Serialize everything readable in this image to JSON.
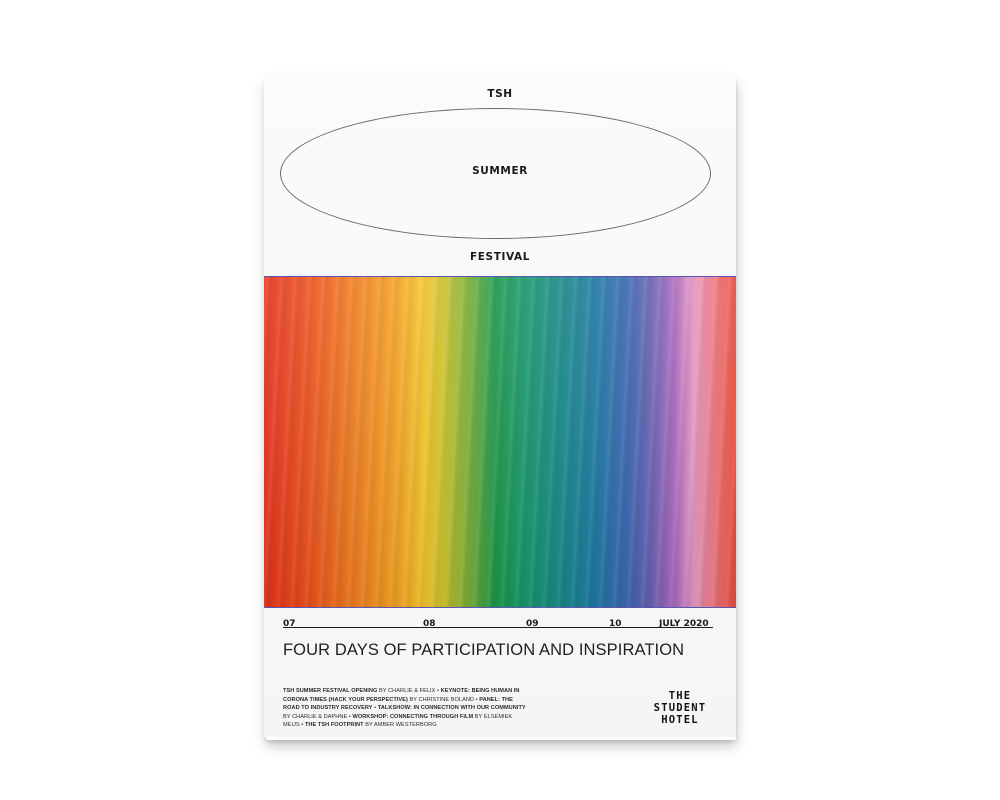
{
  "poster": {
    "title_top": "TSH",
    "title_middle": "SUMMER",
    "title_bottom": "FESTIVAL",
    "dates": [
      "07",
      "08",
      "09",
      "10",
      "JULY 2020"
    ],
    "tagline": "FOUR DAYS OF PARTICIPATION AND INSPIRATION",
    "program": [
      {
        "title": "TSH SUMMER FESTIVAL OPENING",
        "by": " BY CHARLIE & FELIX • "
      },
      {
        "title": "KEYNOTE: BEING HUMAN IN CORONA TIMES (HACK YOUR PERSPECTIVE)",
        "by": " BY CHRISTINE BOLAND • "
      },
      {
        "title": "PANEL: THE ROAD TO INDUSTRY RECOVERY",
        "by": " • "
      },
      {
        "title": "TALKSHOW: IN CONNECTION WITH OUR COMMUNITY",
        "by": " BY CHARLIE & DAPHNE • "
      },
      {
        "title": "WORKSHOP: CONNECTING THROUGH FILM",
        "by": " BY ELSEMIEK MEIJS • "
      },
      {
        "title": "THE TSH FOOTPRINT",
        "by": " BY AMBER WESTERBORG"
      }
    ],
    "logo_lines": [
      "THE",
      "STUDENT",
      "HOTEL"
    ],
    "colors": {
      "rainbow_start": "#e8331c",
      "rainbow_mid": "#1d9a4b",
      "rainbow_end": "#ee4d3a",
      "border_accent": "#5a55b0"
    }
  }
}
